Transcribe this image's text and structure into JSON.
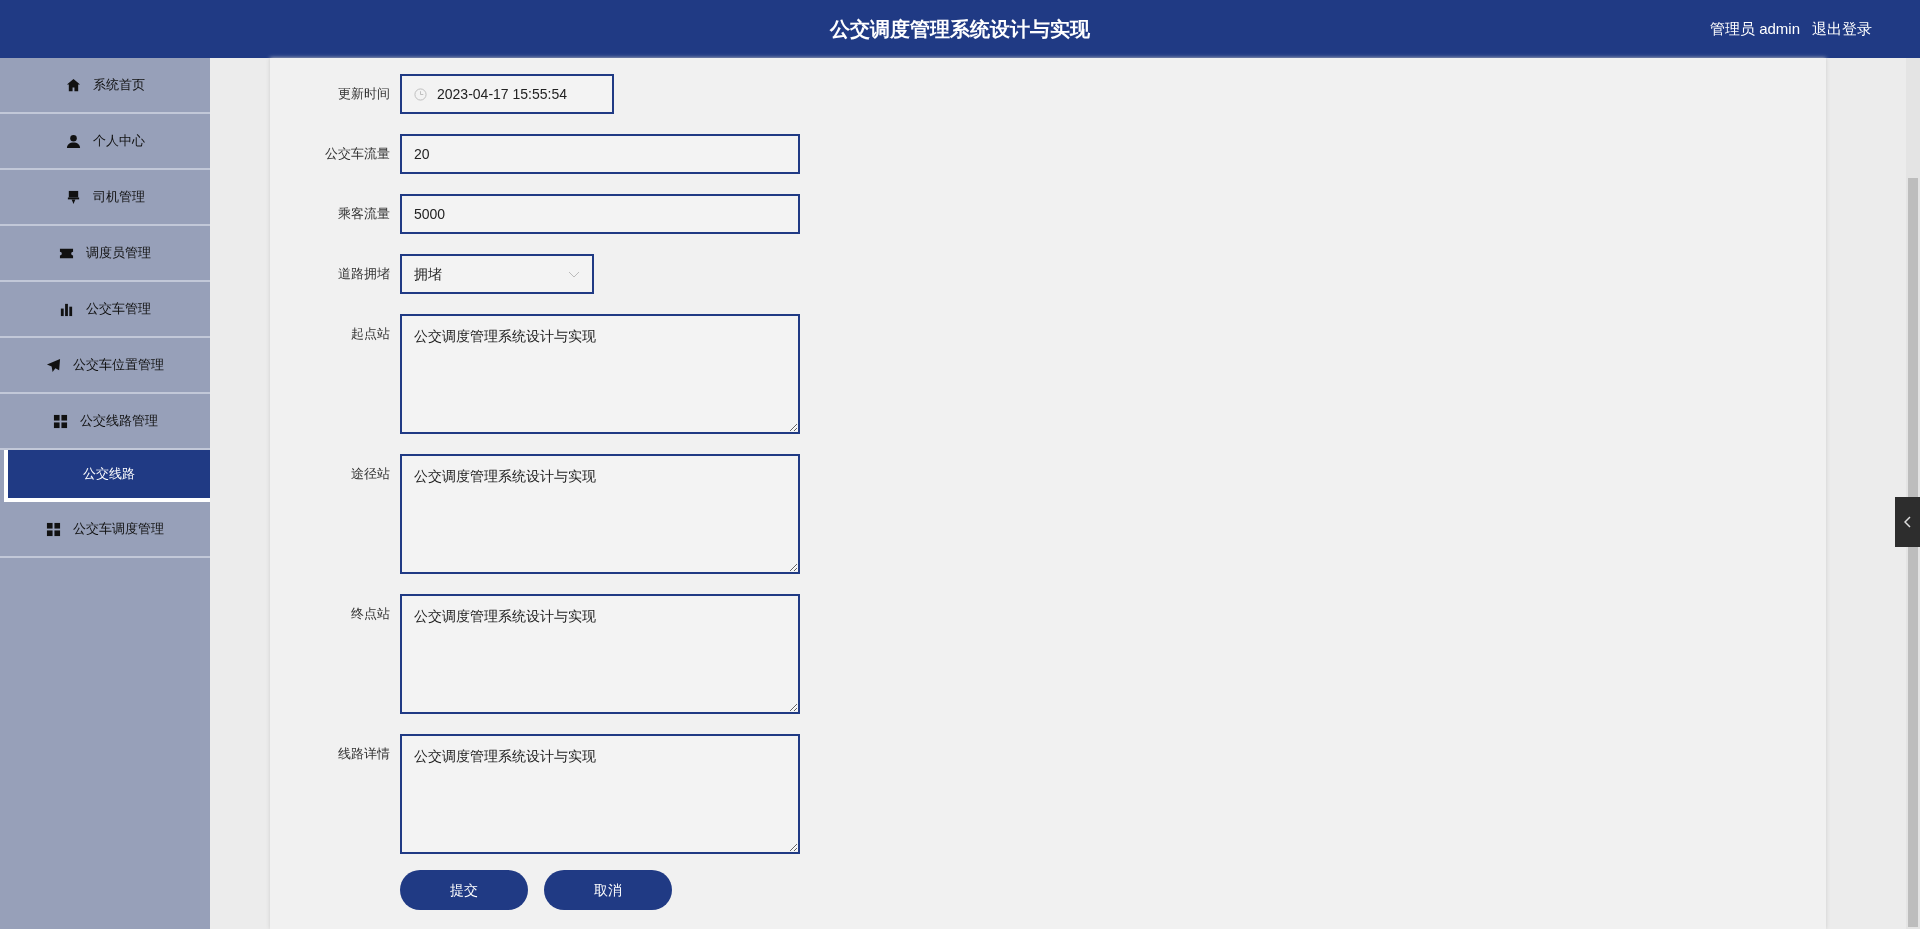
{
  "header": {
    "title": "公交调度管理系统设计与实现",
    "user": "管理员 admin",
    "logout": "退出登录"
  },
  "sidebar": {
    "items": [
      {
        "label": "系统首页",
        "kind": "home",
        "selected": false
      },
      {
        "label": "个人中心",
        "kind": "user",
        "selected": false
      },
      {
        "label": "司机管理",
        "kind": "pin",
        "selected": false
      },
      {
        "label": "调度员管理",
        "kind": "ticket",
        "selected": false
      },
      {
        "label": "公交车管理",
        "kind": "bars",
        "selected": false
      },
      {
        "label": "公交车位置管理",
        "kind": "plane",
        "selected": false
      },
      {
        "label": "公交线路管理",
        "kind": "grid",
        "selected": false
      },
      {
        "label": "公交线路",
        "kind": "sub",
        "selected": true
      },
      {
        "label": "公交车调度管理",
        "kind": "grid",
        "selected": false
      }
    ]
  },
  "form": {
    "fields": [
      {
        "label": "更新时间",
        "kind": "date",
        "value": "2023-04-17 15:55:54"
      },
      {
        "label": "公交车流量",
        "kind": "text",
        "value": "20"
      },
      {
        "label": "乘客流量",
        "kind": "text",
        "value": "5000"
      },
      {
        "label": "道路拥堵",
        "kind": "select",
        "value": "拥堵"
      },
      {
        "label": "起点站",
        "kind": "textarea",
        "value": "公交调度管理系统设计与实现"
      },
      {
        "label": "途径站",
        "kind": "textarea",
        "value": "公交调度管理系统设计与实现"
      },
      {
        "label": "终点站",
        "kind": "textarea",
        "value": "公交调度管理系统设计与实现"
      },
      {
        "label": "线路详情",
        "kind": "textarea",
        "value": "公交调度管理系统设计与实现"
      }
    ],
    "buttons": [
      "提交",
      "取消"
    ]
  }
}
